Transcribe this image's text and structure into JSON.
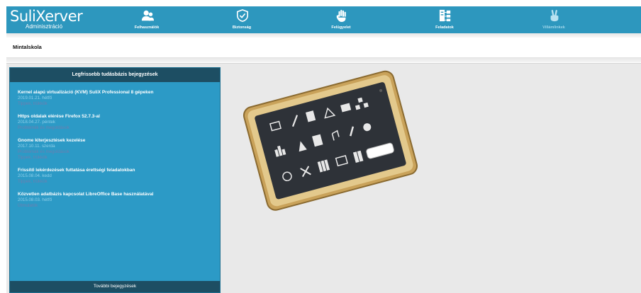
{
  "app": {
    "logo_main": "SuliXerver",
    "logo_sub": "Adminisztráció"
  },
  "nav": {
    "items": [
      {
        "label": "Felhasználók",
        "icon": "users-icon"
      },
      {
        "label": "Biztonság",
        "icon": "shield-icon"
      },
      {
        "label": "Felügyelet",
        "icon": "hand-icon"
      },
      {
        "label": "Feladatok",
        "icon": "tasks-icon"
      },
      {
        "label": "Villámlinkek",
        "icon": "victory-hand-icon"
      }
    ]
  },
  "school": {
    "name": "Mintalskola"
  },
  "knowledge_base": {
    "header": "Legfrissebb tudásbázis bejegyzések",
    "items": [
      {
        "title": "Kernel alapú virtualizáció (KVM) SuliX Professional 8 gépeken",
        "date": "2019.01.21. hétfő",
        "categories": [
          "Tippek, trükkök"
        ]
      },
      {
        "title": "Https oldalak elérése Firefox 52.7.3-al",
        "date": "2018.04.27. péntek",
        "categories": [
          "Problémák és megoldások"
        ]
      },
      {
        "title": "Gnome kiterjesztések kezelése",
        "date": "2017.10.11. szerda",
        "categories": [
          "Problémák és megoldások",
          "Tippek, trükkök"
        ]
      },
      {
        "title": "Frissítő lekérdezések futtatása érettségi feladatokban",
        "date": "2015.08.04. kedd",
        "categories": [
          "Tippek, trükkök"
        ]
      },
      {
        "title": "Közvetlen adatbázis kapcsolat LibreOffice Base használatával",
        "date": "2015.08.03. hétfő",
        "categories": [
          "Útmutatók"
        ]
      }
    ],
    "more_label": "További bejegyzések"
  },
  "colors": {
    "brand": "#2d97be",
    "panel_dark": "#1d4e63",
    "panel_bg": "#2c9ac6"
  }
}
